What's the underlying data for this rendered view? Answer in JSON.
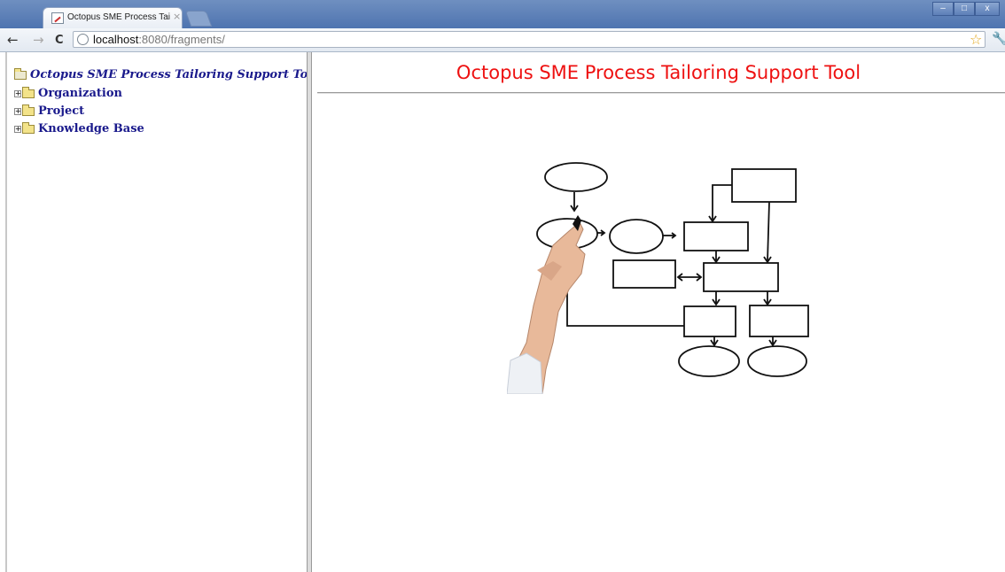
{
  "browser": {
    "tab_title": "Octopus SME Process Tailo",
    "tab_close": "×",
    "back": "←",
    "forward": "→",
    "reload": "C",
    "url_host": "localhost",
    "url_rest": ":8080/fragments/",
    "window_buttons": [
      "–",
      "□",
      "x"
    ]
  },
  "tree": {
    "root_label": "Octopus SME Process Tailoring Support Tool",
    "items": [
      {
        "label": "Organization",
        "expander": "+"
      },
      {
        "label": "Project",
        "expander": "+"
      },
      {
        "label": "Knowledge Base",
        "expander": "+"
      }
    ]
  },
  "main": {
    "heading": "Octopus SME Process Tailoring Support Tool",
    "image_icon": "flowchart-drawing-hand-image"
  },
  "colors": {
    "heading": "#ee1111",
    "tree_text": "#1a1a8c"
  }
}
